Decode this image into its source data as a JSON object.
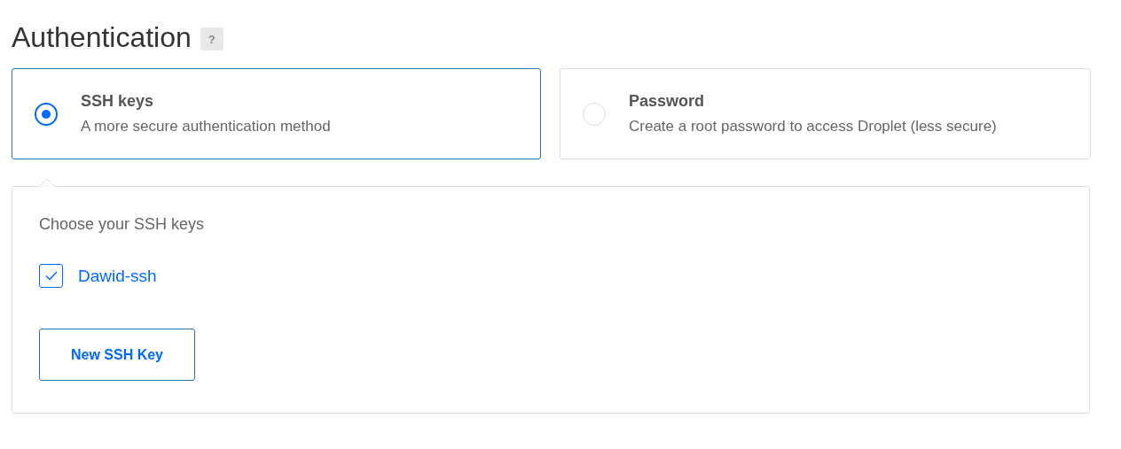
{
  "heading": {
    "title": "Authentication",
    "help": "?"
  },
  "options": [
    {
      "title": "SSH keys",
      "description": "A more secure authentication method",
      "selected": true
    },
    {
      "title": "Password",
      "description": "Create a root password to access Droplet (less secure)",
      "selected": false
    }
  ],
  "ssh_panel": {
    "label": "Choose your SSH keys",
    "keys": [
      {
        "name": "Dawid-ssh",
        "checked": true
      }
    ],
    "button": "New SSH Key"
  }
}
